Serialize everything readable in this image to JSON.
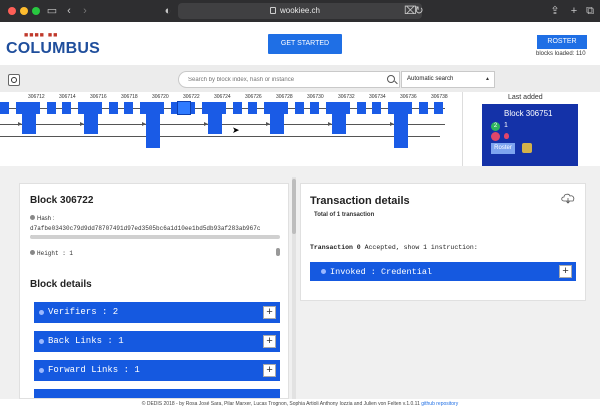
{
  "browser": {
    "url": "wookiee.ch",
    "back_label": "‹",
    "forward_label": "›",
    "sidebar_icon": "sidebar-icon",
    "tabs_icon": "tabs-icon"
  },
  "header": {
    "logo_text": "COLUMBUS",
    "logo_dots": "■■■■ ■■",
    "get_started_label": "GET STARTED",
    "roster_label": "ROSTER",
    "blocks_loaded": "blocks loaded: 110"
  },
  "search": {
    "placeholder": "Search by block index, hash or instance",
    "mode": "Automatic search"
  },
  "timeline": {
    "labels": [
      "306712",
      "306714",
      "306716",
      "306718",
      "306720",
      "306722",
      "306724",
      "306726",
      "306728",
      "306730",
      "306732",
      "306734",
      "306736",
      "306738"
    ],
    "selected_index": 306722,
    "accent": "#1a5be6"
  },
  "last_added": {
    "title": "Last added",
    "block": "Block 306751",
    "count_badge": "2",
    "count": "1",
    "roster_label": "Roster"
  },
  "block": {
    "title": "Block 306722",
    "hash_label": "Hash :",
    "hash_value": "d7afbe03430c79d9dd78707491d97ed3505bc6a1d10ee1bd5db93af283ab967c",
    "validated_text": "Validated on the 2021-11-29 at 07:03:58",
    "height_label": "Height : 1",
    "details_title": "Block details",
    "sections": [
      {
        "label": "Verifiers : 2"
      },
      {
        "label": "Back Links : 1"
      },
      {
        "label": "Forward Links : 1"
      }
    ]
  },
  "transactions": {
    "title": "Transaction details",
    "subtitle": "Total of 1 transaction",
    "line_prefix": "Transaction 0",
    "line_status": " Accepted, show 1 instruction:",
    "instruction_label": "Invoked : Credential"
  },
  "footer": {
    "text": "© DEDIS 2018 - by Rosa José Sara, Pilar Marxer, Lucas Trognon, Sophia Artioli Anthony Iozzia and Julien von Felten v.1.0.11",
    "link": "github repository"
  },
  "colors": {
    "primary": "#1f6fe5",
    "accordion": "#1559e0",
    "last_card": "#1432a8"
  }
}
